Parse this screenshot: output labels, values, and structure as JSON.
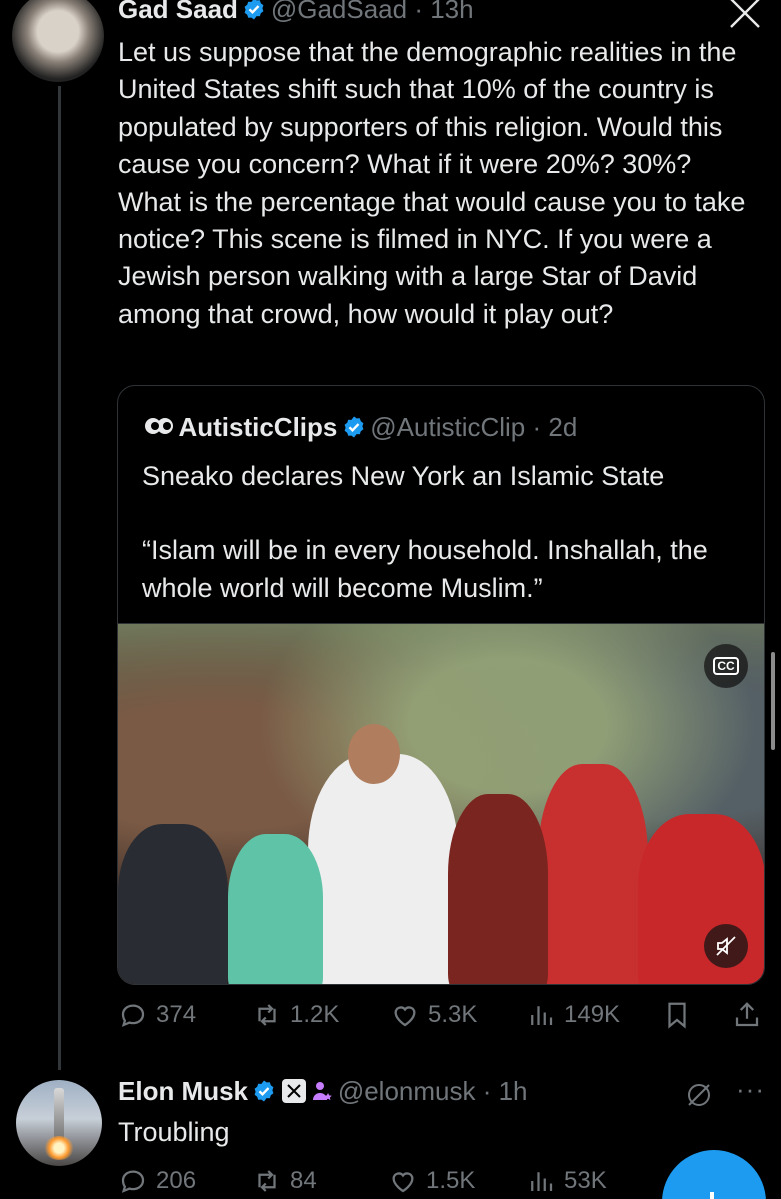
{
  "main_tweet": {
    "author_name": "Gad Saad",
    "handle_time": "@GadSaad · 13h",
    "text": "Let us suppose that the demographic realities in the United States shift such that 10% of the country is populated by supporters of this religion.  Would this cause you concern?  What if it were 20%?  30%?  What is the percentage that would cause you to take notice?   This scene is filmed in NYC.  If you were a Jewish person walking with a large Star of David among that crowd, how would it play out?",
    "actions": {
      "replies": "374",
      "reposts": "1.2K",
      "likes": "5.3K",
      "views": "149K"
    }
  },
  "quote": {
    "author_name": "AutisticClips",
    "handle_time": "@AutisticClip · 2d",
    "line1": "Sneako declares New York an Islamic State",
    "line2": "“Islam will be in every household. Inshallah, the whole world will become Muslim.”",
    "cc_label": "CC"
  },
  "reply": {
    "author_name": "Elon Musk",
    "handle_time": "@elonmusk · 1h",
    "text": "Troubling",
    "actions": {
      "replies": "206",
      "reposts": "84",
      "likes": "1.5K",
      "views": "53K"
    }
  },
  "colors": {
    "background": "#000000",
    "text": "#e7e9ea",
    "muted": "#71767b",
    "accent": "#1d9bf0",
    "border": "#2f3336"
  },
  "icons": [
    "x-logo-icon",
    "verified-icon",
    "reply-icon",
    "repost-icon",
    "like-icon",
    "views-icon",
    "bookmark-icon",
    "share-icon",
    "cc-icon",
    "mute-icon",
    "grok-icon",
    "more-icon",
    "affiliate-icon"
  ]
}
